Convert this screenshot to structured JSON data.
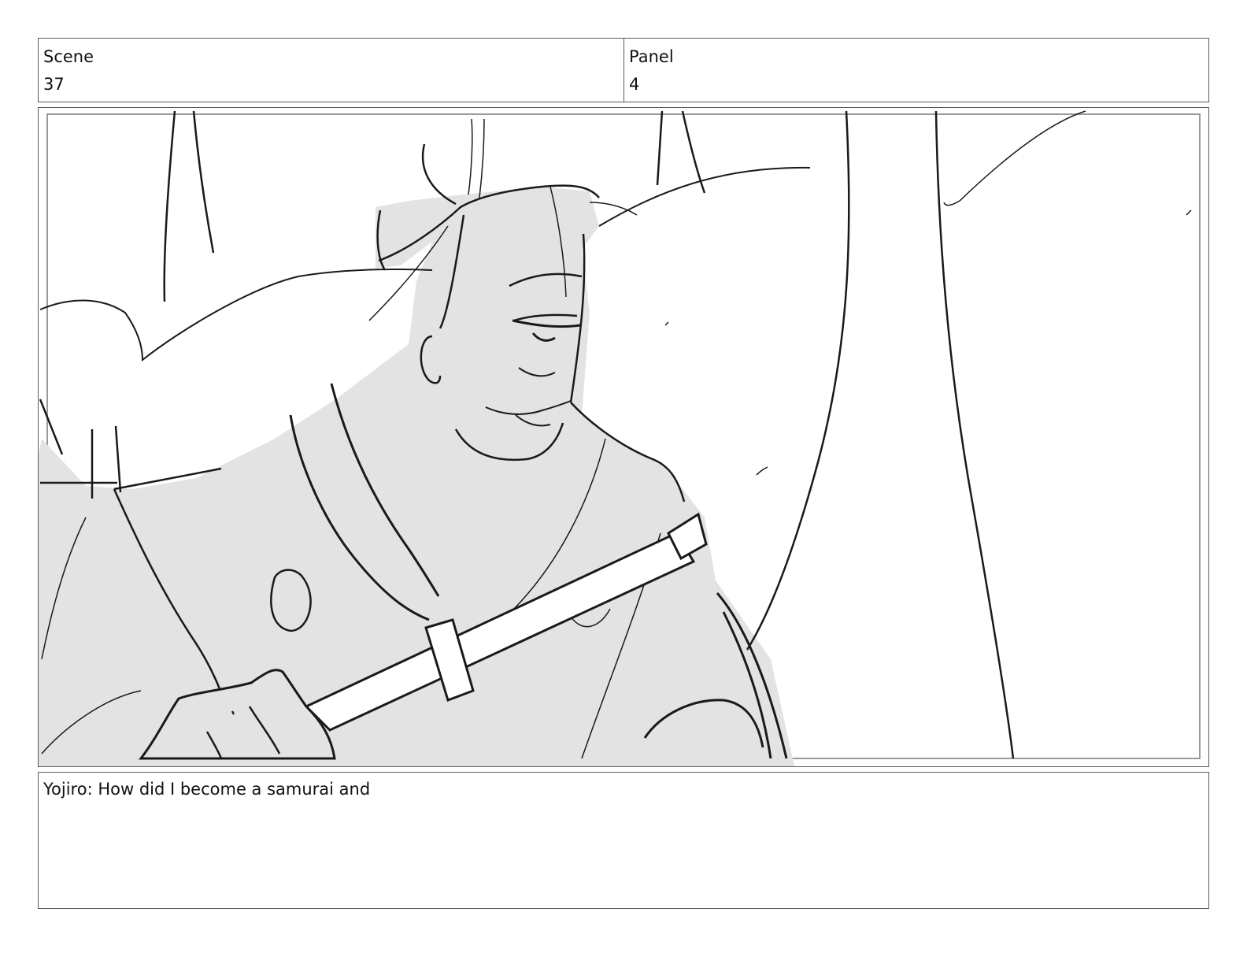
{
  "header": {
    "scene_label": "Scene",
    "scene_value": "37",
    "panel_label": "Panel",
    "panel_value": "4"
  },
  "caption": {
    "dialogue": "Yojiro: How did I become a samurai and"
  },
  "colors": {
    "line": "#1a1a1a",
    "fill": "#e3e3e3",
    "border": "#5a5a5a"
  }
}
